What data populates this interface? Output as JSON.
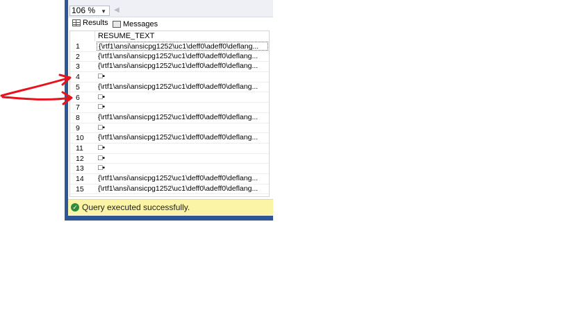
{
  "toolbar": {
    "zoom": "106 %"
  },
  "tabs": [
    {
      "label": "Results",
      "icon": "grid-icon"
    },
    {
      "label": "Messages",
      "icon": "messages-icon"
    }
  ],
  "grid": {
    "column_header": "RESUME_TEXT",
    "rows": [
      {
        "num": "1",
        "text": "{\\rtf1\\ansi\\ansicpg1252\\uc1\\deff0\\adeff0\\deflang..."
      },
      {
        "num": "2",
        "text": "{\\rtf1\\ansi\\ansicpg1252\\uc1\\deff0\\adeff0\\deflang..."
      },
      {
        "num": "3",
        "text": "{\\rtf1\\ansi\\ansicpg1252\\uc1\\deff0\\adeff0\\deflang..."
      },
      {
        "num": "4",
        "text": "□•"
      },
      {
        "num": "5",
        "text": "{\\rtf1\\ansi\\ansicpg1252\\uc1\\deff0\\adeff0\\deflang..."
      },
      {
        "num": "6",
        "text": "□•"
      },
      {
        "num": "7",
        "text": "□•"
      },
      {
        "num": "8",
        "text": "{\\rtf1\\ansi\\ansicpg1252\\uc1\\deff0\\adeff0\\deflang..."
      },
      {
        "num": "9",
        "text": "□•"
      },
      {
        "num": "10",
        "text": "{\\rtf1\\ansi\\ansicpg1252\\uc1\\deff0\\adeff0\\deflang..."
      },
      {
        "num": "11",
        "text": "□•"
      },
      {
        "num": "12",
        "text": "□•"
      },
      {
        "num": "13",
        "text": "□•"
      },
      {
        "num": "14",
        "text": "{\\rtf1\\ansi\\ansicpg1252\\uc1\\deff0\\adeff0\\deflang..."
      },
      {
        "num": "15",
        "text": "{\\rtf1\\ansi\\ansicpg1252\\uc1\\deff0\\adeff0\\deflang..."
      }
    ]
  },
  "status": {
    "text": "Query executed successfully.",
    "color": "#fbf3a6"
  },
  "annotation": {
    "color": "#e8121c"
  }
}
